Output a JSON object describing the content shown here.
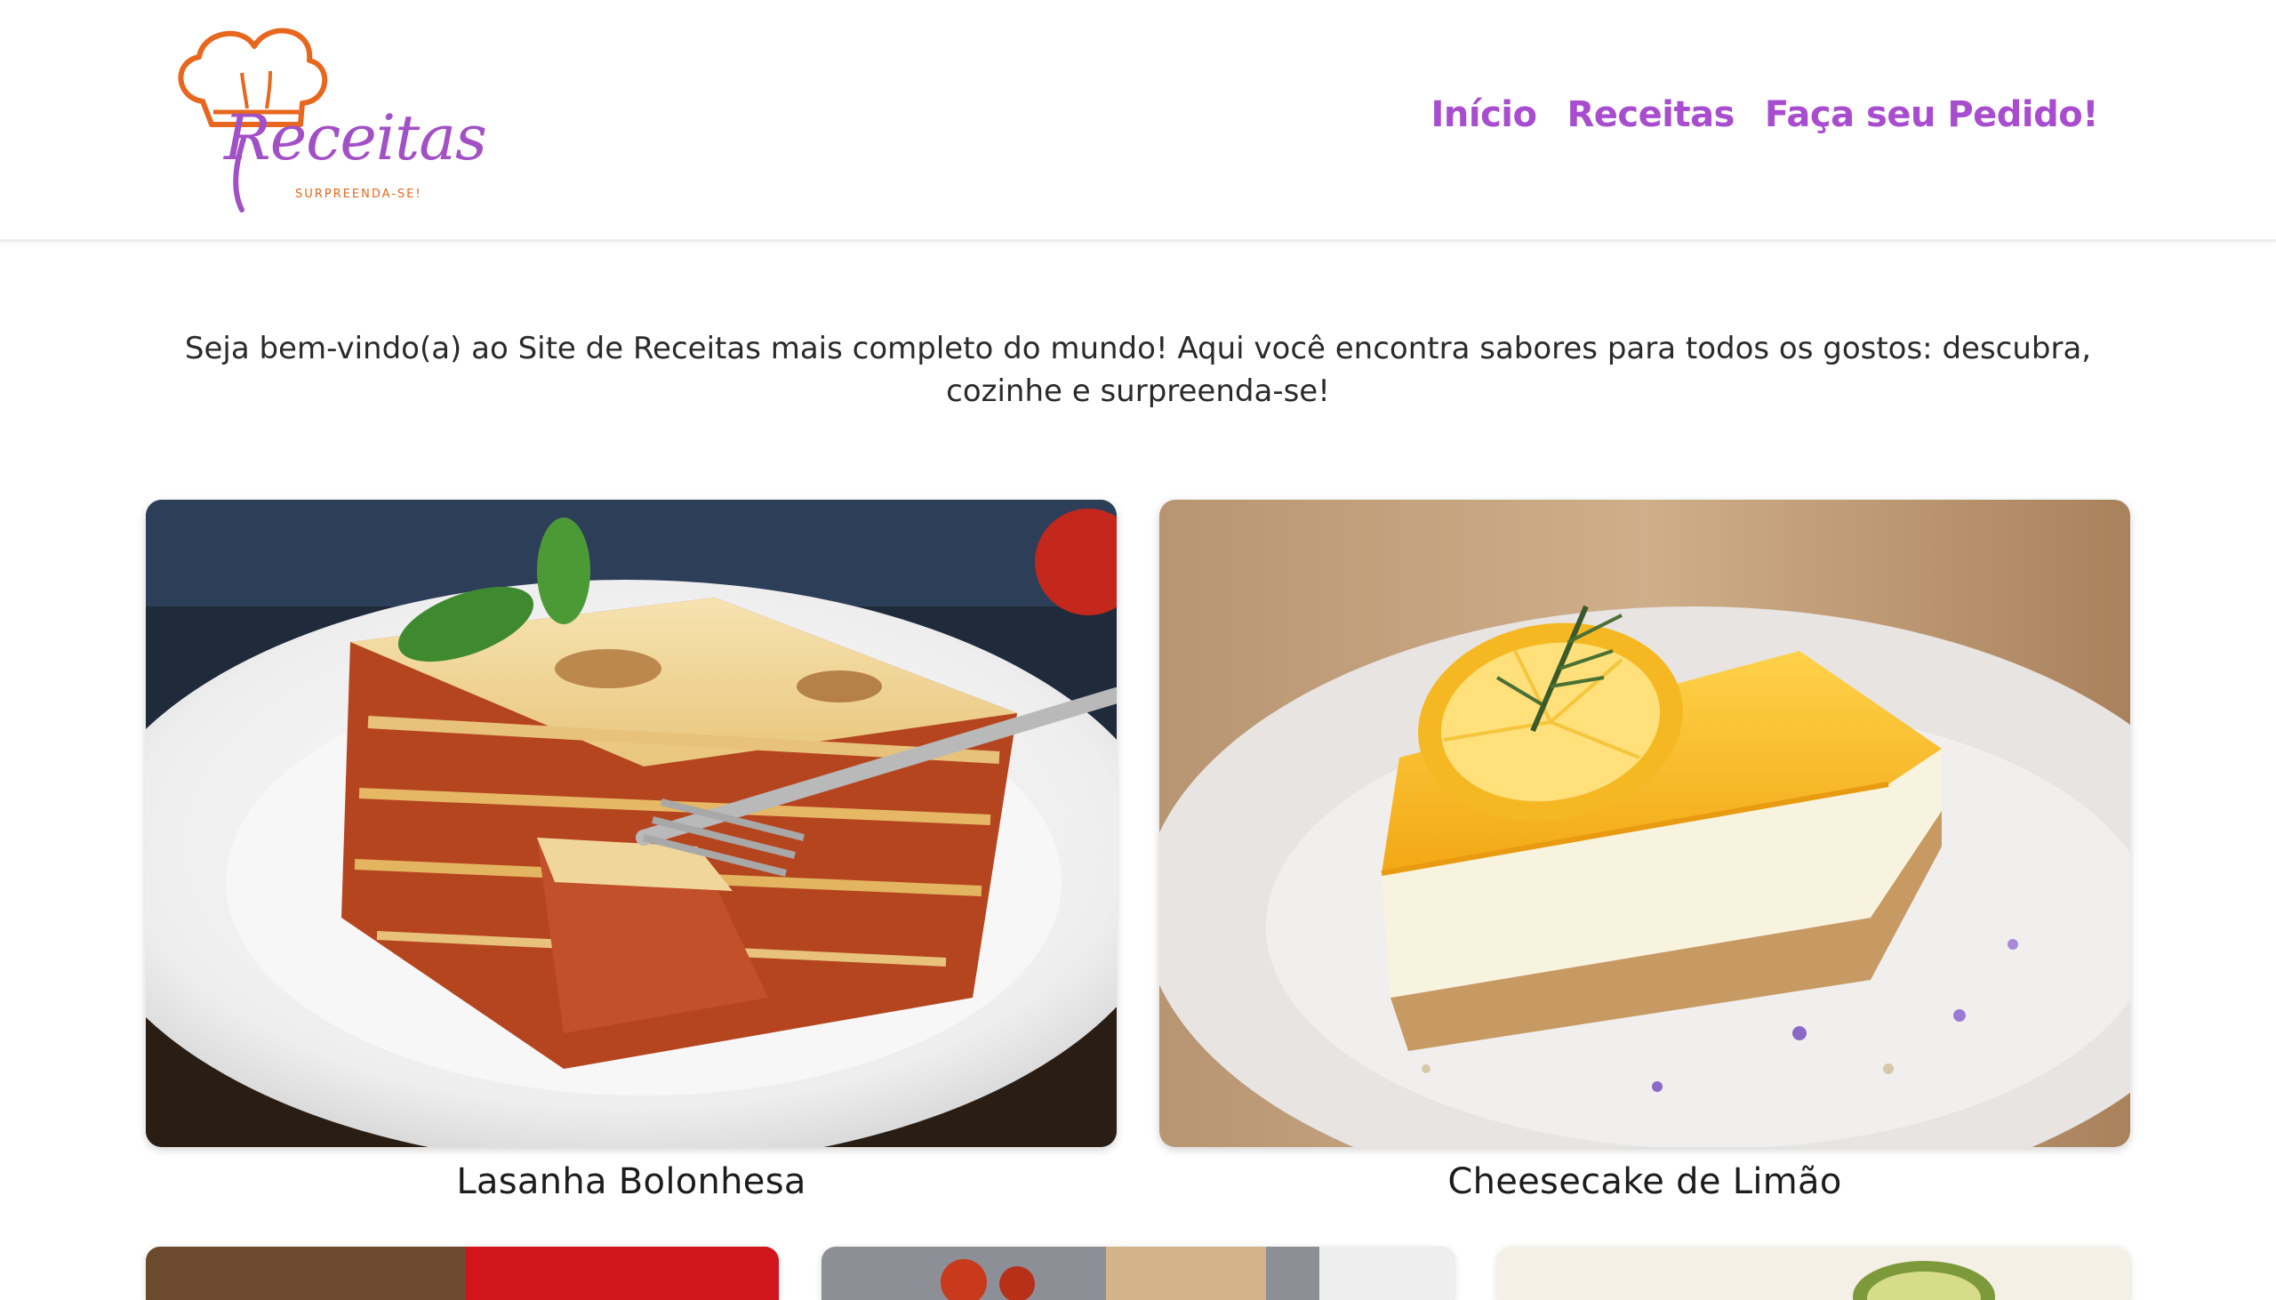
{
  "header": {
    "logo": {
      "wordmark": "Receitas",
      "tagline": "SURPREENDA-SE!",
      "icon": "chef-hat-icon"
    },
    "nav": [
      {
        "label": "Início"
      },
      {
        "label": "Receitas"
      },
      {
        "label": "Faça seu Pedido!"
      }
    ]
  },
  "intro": {
    "text": "Seja bem-vindo(a) ao Site de Receitas mais completo do mundo! Aqui você encontra sabores para todos os gostos: descubra, cozinhe e surpreenda-se!"
  },
  "recipes": [
    {
      "title": "Lasanha Bolonhesa",
      "image": "lasagna-photo"
    },
    {
      "title": "Cheesecake de Limão",
      "image": "lemon-cheesecake-photo"
    }
  ],
  "more_recipes": [
    {
      "image": "recipe-photo-red"
    },
    {
      "image": "recipe-photo-tomatoes"
    },
    {
      "image": "recipe-photo-avocado"
    }
  ],
  "colors": {
    "brand_purple": "#a84dcf",
    "brand_orange": "#e8671e",
    "text": "#2a2a2a"
  }
}
